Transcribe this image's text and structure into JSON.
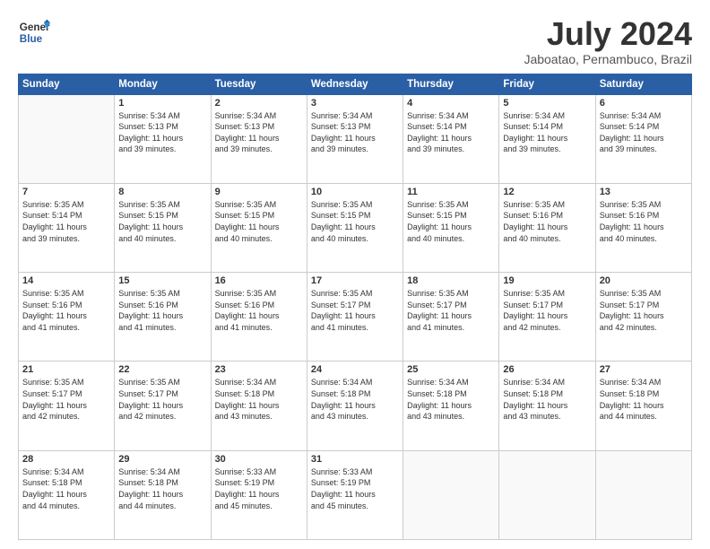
{
  "logo": {
    "line1": "General",
    "line2": "Blue"
  },
  "title": "July 2024",
  "location": "Jaboatao, Pernambuco, Brazil",
  "days_header": [
    "Sunday",
    "Monday",
    "Tuesday",
    "Wednesday",
    "Thursday",
    "Friday",
    "Saturday"
  ],
  "weeks": [
    [
      {
        "day": "",
        "info": ""
      },
      {
        "day": "1",
        "info": "Sunrise: 5:34 AM\nSunset: 5:13 PM\nDaylight: 11 hours\nand 39 minutes."
      },
      {
        "day": "2",
        "info": "Sunrise: 5:34 AM\nSunset: 5:13 PM\nDaylight: 11 hours\nand 39 minutes."
      },
      {
        "day": "3",
        "info": "Sunrise: 5:34 AM\nSunset: 5:13 PM\nDaylight: 11 hours\nand 39 minutes."
      },
      {
        "day": "4",
        "info": "Sunrise: 5:34 AM\nSunset: 5:14 PM\nDaylight: 11 hours\nand 39 minutes."
      },
      {
        "day": "5",
        "info": "Sunrise: 5:34 AM\nSunset: 5:14 PM\nDaylight: 11 hours\nand 39 minutes."
      },
      {
        "day": "6",
        "info": "Sunrise: 5:34 AM\nSunset: 5:14 PM\nDaylight: 11 hours\nand 39 minutes."
      }
    ],
    [
      {
        "day": "7",
        "info": "Sunrise: 5:35 AM\nSunset: 5:14 PM\nDaylight: 11 hours\nand 39 minutes."
      },
      {
        "day": "8",
        "info": "Sunrise: 5:35 AM\nSunset: 5:15 PM\nDaylight: 11 hours\nand 40 minutes."
      },
      {
        "day": "9",
        "info": "Sunrise: 5:35 AM\nSunset: 5:15 PM\nDaylight: 11 hours\nand 40 minutes."
      },
      {
        "day": "10",
        "info": "Sunrise: 5:35 AM\nSunset: 5:15 PM\nDaylight: 11 hours\nand 40 minutes."
      },
      {
        "day": "11",
        "info": "Sunrise: 5:35 AM\nSunset: 5:15 PM\nDaylight: 11 hours\nand 40 minutes."
      },
      {
        "day": "12",
        "info": "Sunrise: 5:35 AM\nSunset: 5:16 PM\nDaylight: 11 hours\nand 40 minutes."
      },
      {
        "day": "13",
        "info": "Sunrise: 5:35 AM\nSunset: 5:16 PM\nDaylight: 11 hours\nand 40 minutes."
      }
    ],
    [
      {
        "day": "14",
        "info": "Sunrise: 5:35 AM\nSunset: 5:16 PM\nDaylight: 11 hours\nand 41 minutes."
      },
      {
        "day": "15",
        "info": "Sunrise: 5:35 AM\nSunset: 5:16 PM\nDaylight: 11 hours\nand 41 minutes."
      },
      {
        "day": "16",
        "info": "Sunrise: 5:35 AM\nSunset: 5:16 PM\nDaylight: 11 hours\nand 41 minutes."
      },
      {
        "day": "17",
        "info": "Sunrise: 5:35 AM\nSunset: 5:17 PM\nDaylight: 11 hours\nand 41 minutes."
      },
      {
        "day": "18",
        "info": "Sunrise: 5:35 AM\nSunset: 5:17 PM\nDaylight: 11 hours\nand 41 minutes."
      },
      {
        "day": "19",
        "info": "Sunrise: 5:35 AM\nSunset: 5:17 PM\nDaylight: 11 hours\nand 42 minutes."
      },
      {
        "day": "20",
        "info": "Sunrise: 5:35 AM\nSunset: 5:17 PM\nDaylight: 11 hours\nand 42 minutes."
      }
    ],
    [
      {
        "day": "21",
        "info": "Sunrise: 5:35 AM\nSunset: 5:17 PM\nDaylight: 11 hours\nand 42 minutes."
      },
      {
        "day": "22",
        "info": "Sunrise: 5:35 AM\nSunset: 5:17 PM\nDaylight: 11 hours\nand 42 minutes."
      },
      {
        "day": "23",
        "info": "Sunrise: 5:34 AM\nSunset: 5:18 PM\nDaylight: 11 hours\nand 43 minutes."
      },
      {
        "day": "24",
        "info": "Sunrise: 5:34 AM\nSunset: 5:18 PM\nDaylight: 11 hours\nand 43 minutes."
      },
      {
        "day": "25",
        "info": "Sunrise: 5:34 AM\nSunset: 5:18 PM\nDaylight: 11 hours\nand 43 minutes."
      },
      {
        "day": "26",
        "info": "Sunrise: 5:34 AM\nSunset: 5:18 PM\nDaylight: 11 hours\nand 43 minutes."
      },
      {
        "day": "27",
        "info": "Sunrise: 5:34 AM\nSunset: 5:18 PM\nDaylight: 11 hours\nand 44 minutes."
      }
    ],
    [
      {
        "day": "28",
        "info": "Sunrise: 5:34 AM\nSunset: 5:18 PM\nDaylight: 11 hours\nand 44 minutes."
      },
      {
        "day": "29",
        "info": "Sunrise: 5:34 AM\nSunset: 5:18 PM\nDaylight: 11 hours\nand 44 minutes."
      },
      {
        "day": "30",
        "info": "Sunrise: 5:33 AM\nSunset: 5:19 PM\nDaylight: 11 hours\nand 45 minutes."
      },
      {
        "day": "31",
        "info": "Sunrise: 5:33 AM\nSunset: 5:19 PM\nDaylight: 11 hours\nand 45 minutes."
      },
      {
        "day": "",
        "info": ""
      },
      {
        "day": "",
        "info": ""
      },
      {
        "day": "",
        "info": ""
      }
    ]
  ]
}
